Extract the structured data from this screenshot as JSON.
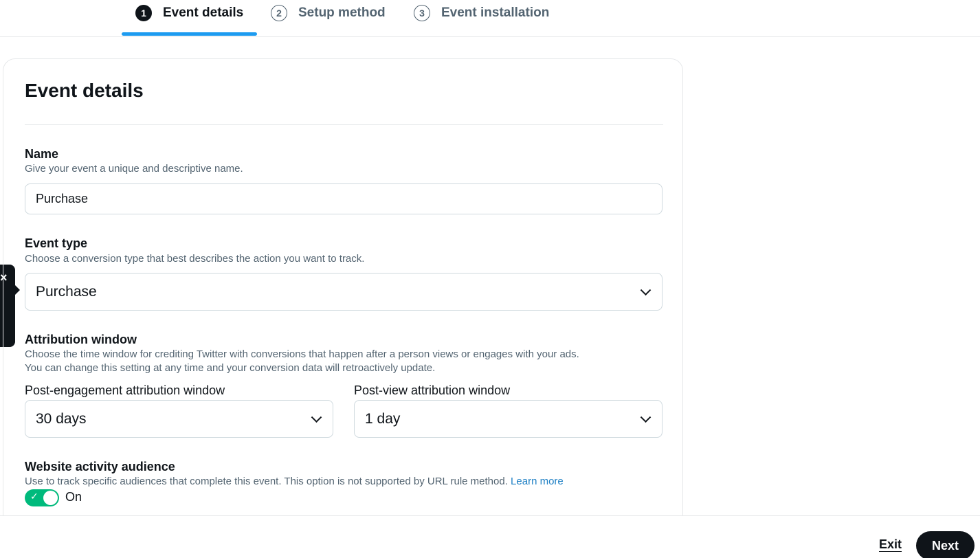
{
  "stepper": {
    "steps": [
      {
        "number": "1",
        "label": "Event details",
        "active": true
      },
      {
        "number": "2",
        "label": "Setup method",
        "active": false
      },
      {
        "number": "3",
        "label": "Event installation",
        "active": false
      }
    ]
  },
  "card": {
    "title": "Event details",
    "name": {
      "label": "Name",
      "help": "Give your event a unique and descriptive name.",
      "value": "Purchase"
    },
    "event_type": {
      "label": "Event type",
      "help": "Choose a conversion type that best describes the action you want to track.",
      "value": "Purchase"
    },
    "attribution": {
      "label": "Attribution window",
      "help_line1": "Choose the time window for crediting Twitter with conversions that happen after a person views or engages with your ads.",
      "help_line2": "You can change this setting at any time and your conversion data will retroactively update.",
      "post_engagement": {
        "label": "Post-engagement attribution window",
        "value": "30 days"
      },
      "post_view": {
        "label": "Post-view attribution window",
        "value": "1 day"
      }
    },
    "audience": {
      "label": "Website activity audience",
      "help": "Use to track specific audiences that complete this event. This option is not supported by URL rule method. ",
      "learn_more": "Learn more",
      "toggle_state": "On",
      "toggle_on": true
    }
  },
  "side_tooltip": {
    "close_icon": "×"
  },
  "footer": {
    "exit_label": "Exit",
    "next_label": "Next"
  },
  "colors": {
    "accent": "#1d9bf0",
    "toggle_on": "#00ba7c",
    "link": "#1d7fc4",
    "primary_button": "#0f1419"
  }
}
